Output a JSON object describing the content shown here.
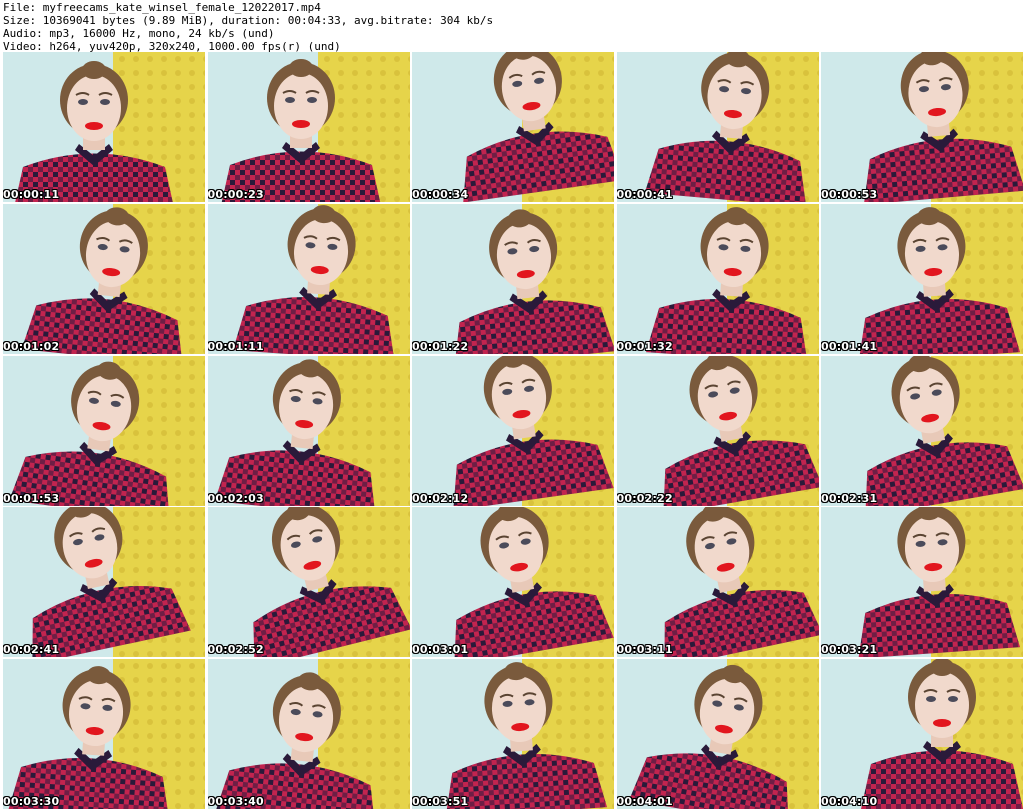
{
  "header": {
    "file": "File: myfreecams_kate_winsel_female_12022017.mp4",
    "size": "Size: 10369041 bytes (9.89 MiB), duration: 00:04:33, avg.bitrate: 304 kb/s",
    "audio": "Audio: mp3, 16000 Hz, mono, 24 kb/s (und)",
    "video": "Video: h264, yuv420p, 320x240, 1000.00 fps(r) (und)"
  },
  "colors": {
    "wall": "#cfe9ea",
    "wallpaper": "#e6d44a",
    "shirt_red": "#c2244f",
    "shirt_dark": "#2a1a3a",
    "skin": "#f1d9cc",
    "hair": "#7a5a3c",
    "lips": "#e2161e"
  },
  "thumbnails": [
    {
      "timestamp": "00:00:11"
    },
    {
      "timestamp": "00:00:23"
    },
    {
      "timestamp": "00:00:34"
    },
    {
      "timestamp": "00:00:41"
    },
    {
      "timestamp": "00:00:53"
    },
    {
      "timestamp": "00:01:02"
    },
    {
      "timestamp": "00:01:11"
    },
    {
      "timestamp": "00:01:22"
    },
    {
      "timestamp": "00:01:32"
    },
    {
      "timestamp": "00:01:41"
    },
    {
      "timestamp": "00:01:53"
    },
    {
      "timestamp": "00:02:03"
    },
    {
      "timestamp": "00:02:12"
    },
    {
      "timestamp": "00:02:22"
    },
    {
      "timestamp": "00:02:31"
    },
    {
      "timestamp": "00:02:41"
    },
    {
      "timestamp": "00:02:52"
    },
    {
      "timestamp": "00:03:01"
    },
    {
      "timestamp": "00:03:11"
    },
    {
      "timestamp": "00:03:21"
    },
    {
      "timestamp": "00:03:30"
    },
    {
      "timestamp": "00:03:40"
    },
    {
      "timestamp": "00:03:51"
    },
    {
      "timestamp": "00:04:01"
    },
    {
      "timestamp": "00:04:10"
    }
  ]
}
